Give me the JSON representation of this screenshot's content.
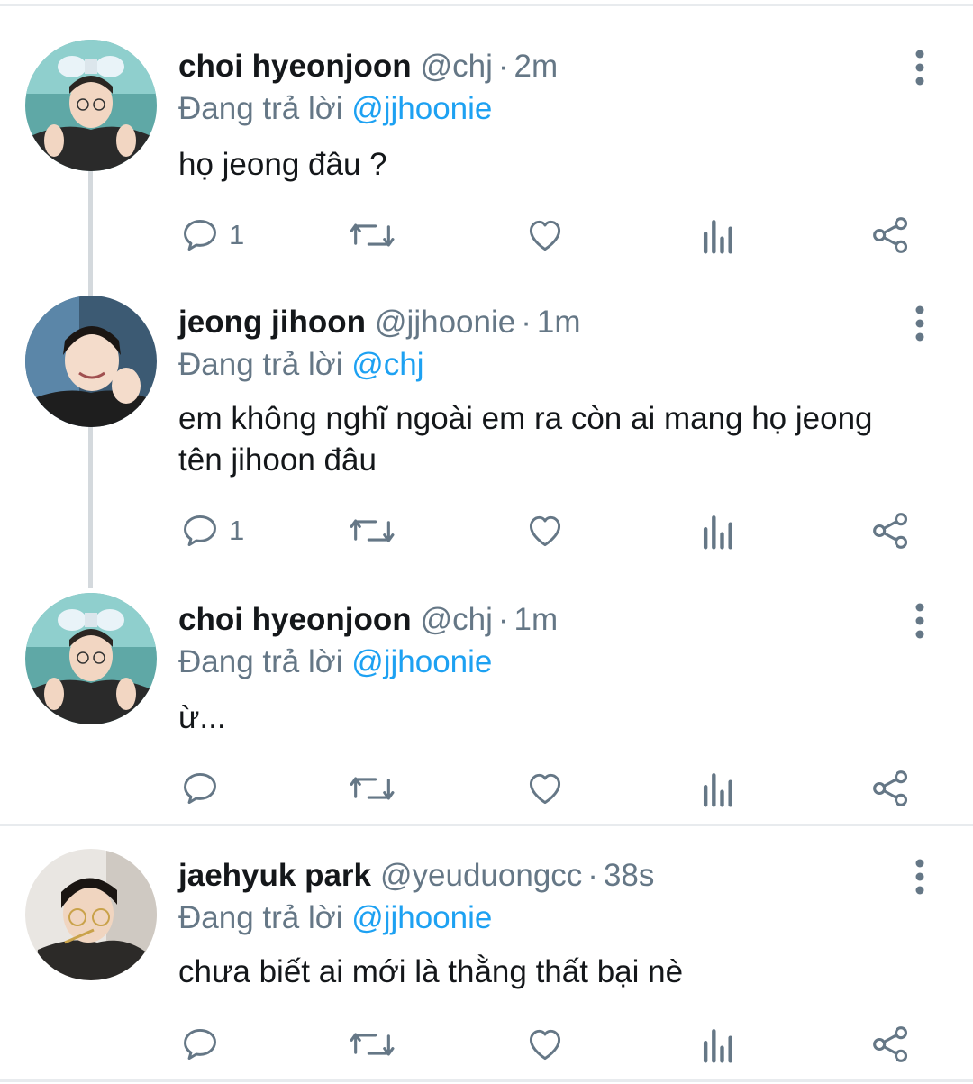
{
  "reply_prefix": "Đang trả lời",
  "tweets": [
    {
      "name": "choi hyeonjoon",
      "handle": "@chj",
      "separator": "·",
      "time": "2m",
      "reply_to": "@jjhoonie",
      "text": "họ jeong đâu ?",
      "reply_count": "1",
      "avatar": "avatar-choi-hyeonjoon"
    },
    {
      "name": "jeong jihoon",
      "handle": "@jjhoonie",
      "separator": "·",
      "time": "1m",
      "reply_to": "@chj",
      "text": "em không nghĩ ngoài em ra còn ai mang họ jeong tên jihoon đâu",
      "reply_count": "1",
      "avatar": "avatar-jeong-jihoon"
    },
    {
      "name": "choi hyeonjoon",
      "handle": "@chj",
      "separator": "·",
      "time": "1m",
      "reply_to": "@jjhoonie",
      "text": "ừ...",
      "reply_count": "",
      "avatar": "avatar-choi-hyeonjoon"
    },
    {
      "name": "jaehyuk park",
      "handle": "@yeuduongcc",
      "separator": "·",
      "time": "38s",
      "reply_to": "@jjhoonie",
      "text": "chưa biết ai mới là thằng thất bại nè",
      "reply_count": "",
      "avatar": "avatar-jaehyuk-park"
    }
  ],
  "icons": {
    "reply": "reply-icon",
    "retweet": "retweet-icon",
    "like": "heart-icon",
    "analytics": "analytics-icon",
    "share": "share-icon",
    "more": "more-vertical-icon"
  },
  "colors": {
    "text": "#14171a",
    "secondary": "#657786",
    "mention": "#1da1f2",
    "divider": "#e8ebee"
  }
}
